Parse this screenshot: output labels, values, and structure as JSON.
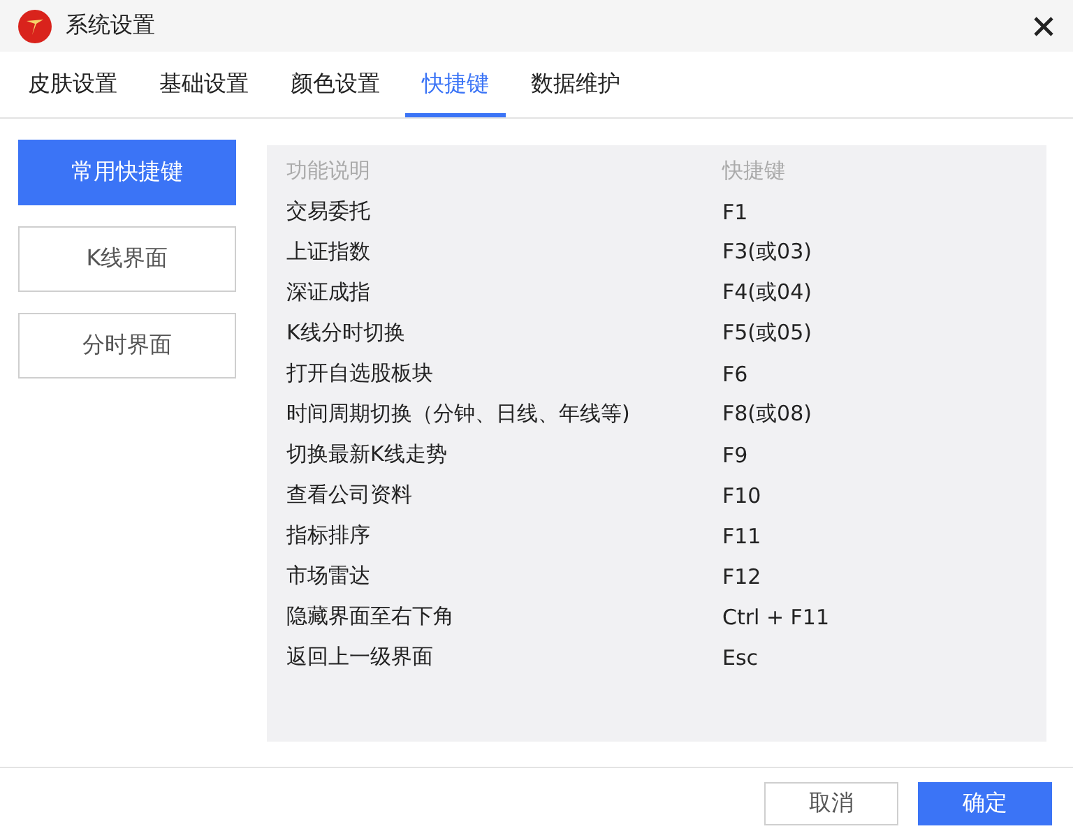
{
  "window": {
    "title": "系统设置"
  },
  "tabs": [
    {
      "label": "皮肤设置",
      "selected": false
    },
    {
      "label": "基础设置",
      "selected": false
    },
    {
      "label": "颜色设置",
      "selected": false
    },
    {
      "label": "快捷键",
      "selected": true
    },
    {
      "label": "数据维护",
      "selected": false
    }
  ],
  "sidebar": {
    "items": [
      {
        "label": "常用快捷键",
        "selected": true
      },
      {
        "label": "K线界面",
        "selected": false
      },
      {
        "label": "分时界面",
        "selected": false
      }
    ]
  },
  "table": {
    "columns": [
      "功能说明",
      "快捷键"
    ],
    "rows": [
      [
        "交易委托",
        "F1"
      ],
      [
        "上证指数",
        "F3(或03)"
      ],
      [
        "深证成指",
        "F4(或04)"
      ],
      [
        "K线分时切换",
        "F5(或05)"
      ],
      [
        "打开自选股板块",
        "F6"
      ],
      [
        "时间周期切换（分钟、日线、年线等)",
        "F8(或08)"
      ],
      [
        "切换最新K线走势",
        "F9"
      ],
      [
        "查看公司资料",
        "F10"
      ],
      [
        "指标排序",
        "F11"
      ],
      [
        "市场雷达",
        "F12"
      ],
      [
        "隐藏界面至右下角",
        "Ctrl + F11"
      ],
      [
        "返回上一级界面",
        "Esc"
      ]
    ]
  },
  "buttons": [
    {
      "label": "取消",
      "kind": "secondary"
    },
    {
      "label": "确定",
      "kind": "primary"
    }
  ]
}
